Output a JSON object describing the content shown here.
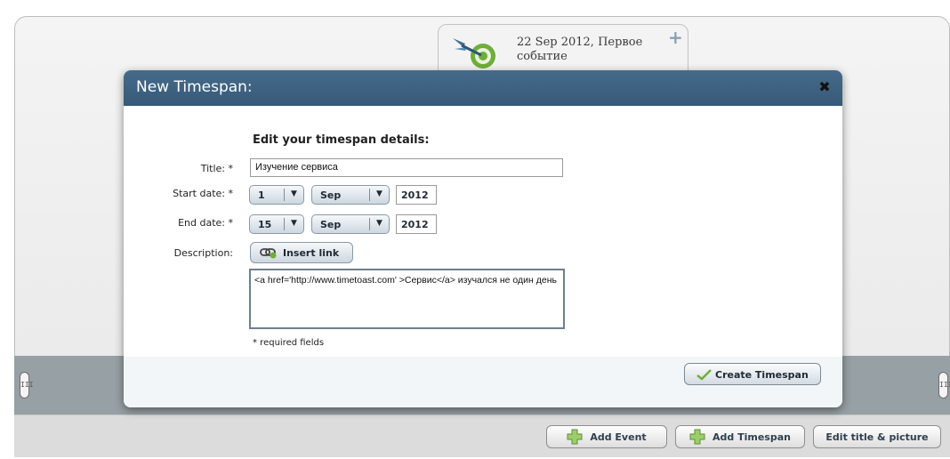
{
  "event_card": {
    "title": "22 Sep 2012, Первое событие",
    "icon": "target-arrow-icon",
    "add_icon": "plus-icon"
  },
  "scroll_handles": {
    "left_glyph": "III",
    "right_glyph": "III"
  },
  "toolbar": {
    "add_event": "Add Event",
    "add_timespan": "Add Timespan",
    "edit_title_picture": "Edit title & picture"
  },
  "modal": {
    "title": "New Timespan:",
    "close_glyph": "✖",
    "heading": "Edit your timespan details:",
    "title_label": "Title: *",
    "title_value": "Изучение сервиса",
    "start_label": "Start date: *",
    "start_day": "1",
    "start_month": "Sep",
    "start_year": "2012",
    "end_label": "End date: *",
    "end_day": "15",
    "end_month": "Sep",
    "end_year": "2012",
    "description_label": "Description:",
    "insert_link": "Insert link",
    "description_value": "<a href='http://www.timetoast.com' >Сервис</a> изучался не один день",
    "required_note": "* required fields",
    "create_button": "Create Timespan"
  },
  "colors": {
    "header_bg": "#3d6281",
    "band_bg": "#97a0a5",
    "accent_green": "#6fae3a"
  }
}
